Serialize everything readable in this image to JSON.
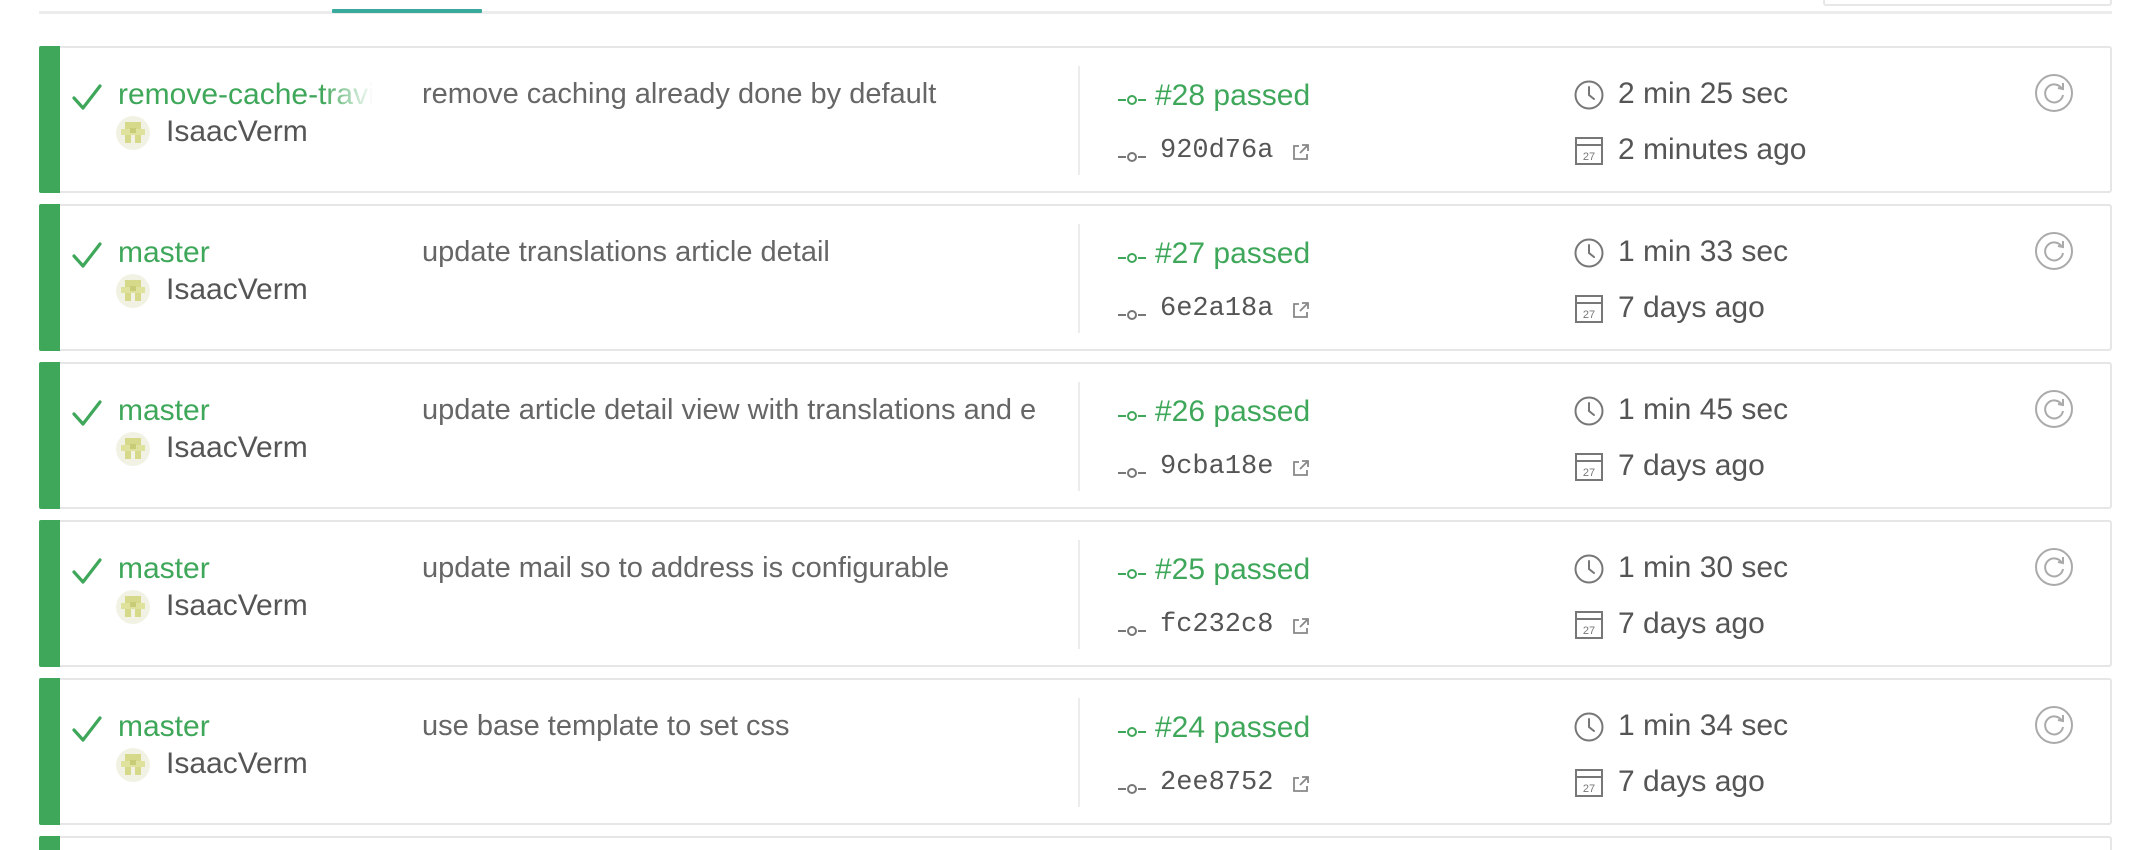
{
  "colors": {
    "passed": "#3fa75a",
    "tab_accent": "#39aa9c",
    "text": "#555555",
    "border": "#e6e6e6"
  },
  "builds": [
    {
      "status": "passed",
      "branch": "remove-cache-travis",
      "author": "IsaacVerm",
      "message": "remove caching already done by default",
      "build_label": "#28 passed",
      "commit_sha": "920d76a",
      "duration": "2 min 25 sec",
      "finished": "2 minutes ago"
    },
    {
      "status": "passed",
      "branch": "master",
      "author": "IsaacVerm",
      "message": "update translations article detail",
      "build_label": "#27 passed",
      "commit_sha": "6e2a18a",
      "duration": "1 min 33 sec",
      "finished": "7 days ago"
    },
    {
      "status": "passed",
      "branch": "master",
      "author": "IsaacVerm",
      "message": "update article detail view with translations and e",
      "build_label": "#26 passed",
      "commit_sha": "9cba18e",
      "duration": "1 min 45 sec",
      "finished": "7 days ago"
    },
    {
      "status": "passed",
      "branch": "master",
      "author": "IsaacVerm",
      "message": "update mail so to address is configurable",
      "build_label": "#25 passed",
      "commit_sha": "fc232c8",
      "duration": "1 min 30 sec",
      "finished": "7 days ago"
    },
    {
      "status": "passed",
      "branch": "master",
      "author": "IsaacVerm",
      "message": "use base template to set css",
      "build_label": "#24 passed",
      "commit_sha": "2ee8752",
      "duration": "1 min 34 sec",
      "finished": "7 days ago"
    }
  ],
  "icons": {
    "status": "check-icon",
    "avatar": "identicon-avatar",
    "build": "commit-node-icon",
    "sha": "commit-node-icon",
    "external": "external-link-icon",
    "duration": "clock-icon",
    "finished": "calendar-icon",
    "restart": "restart-icon",
    "calendar_day": "27"
  }
}
